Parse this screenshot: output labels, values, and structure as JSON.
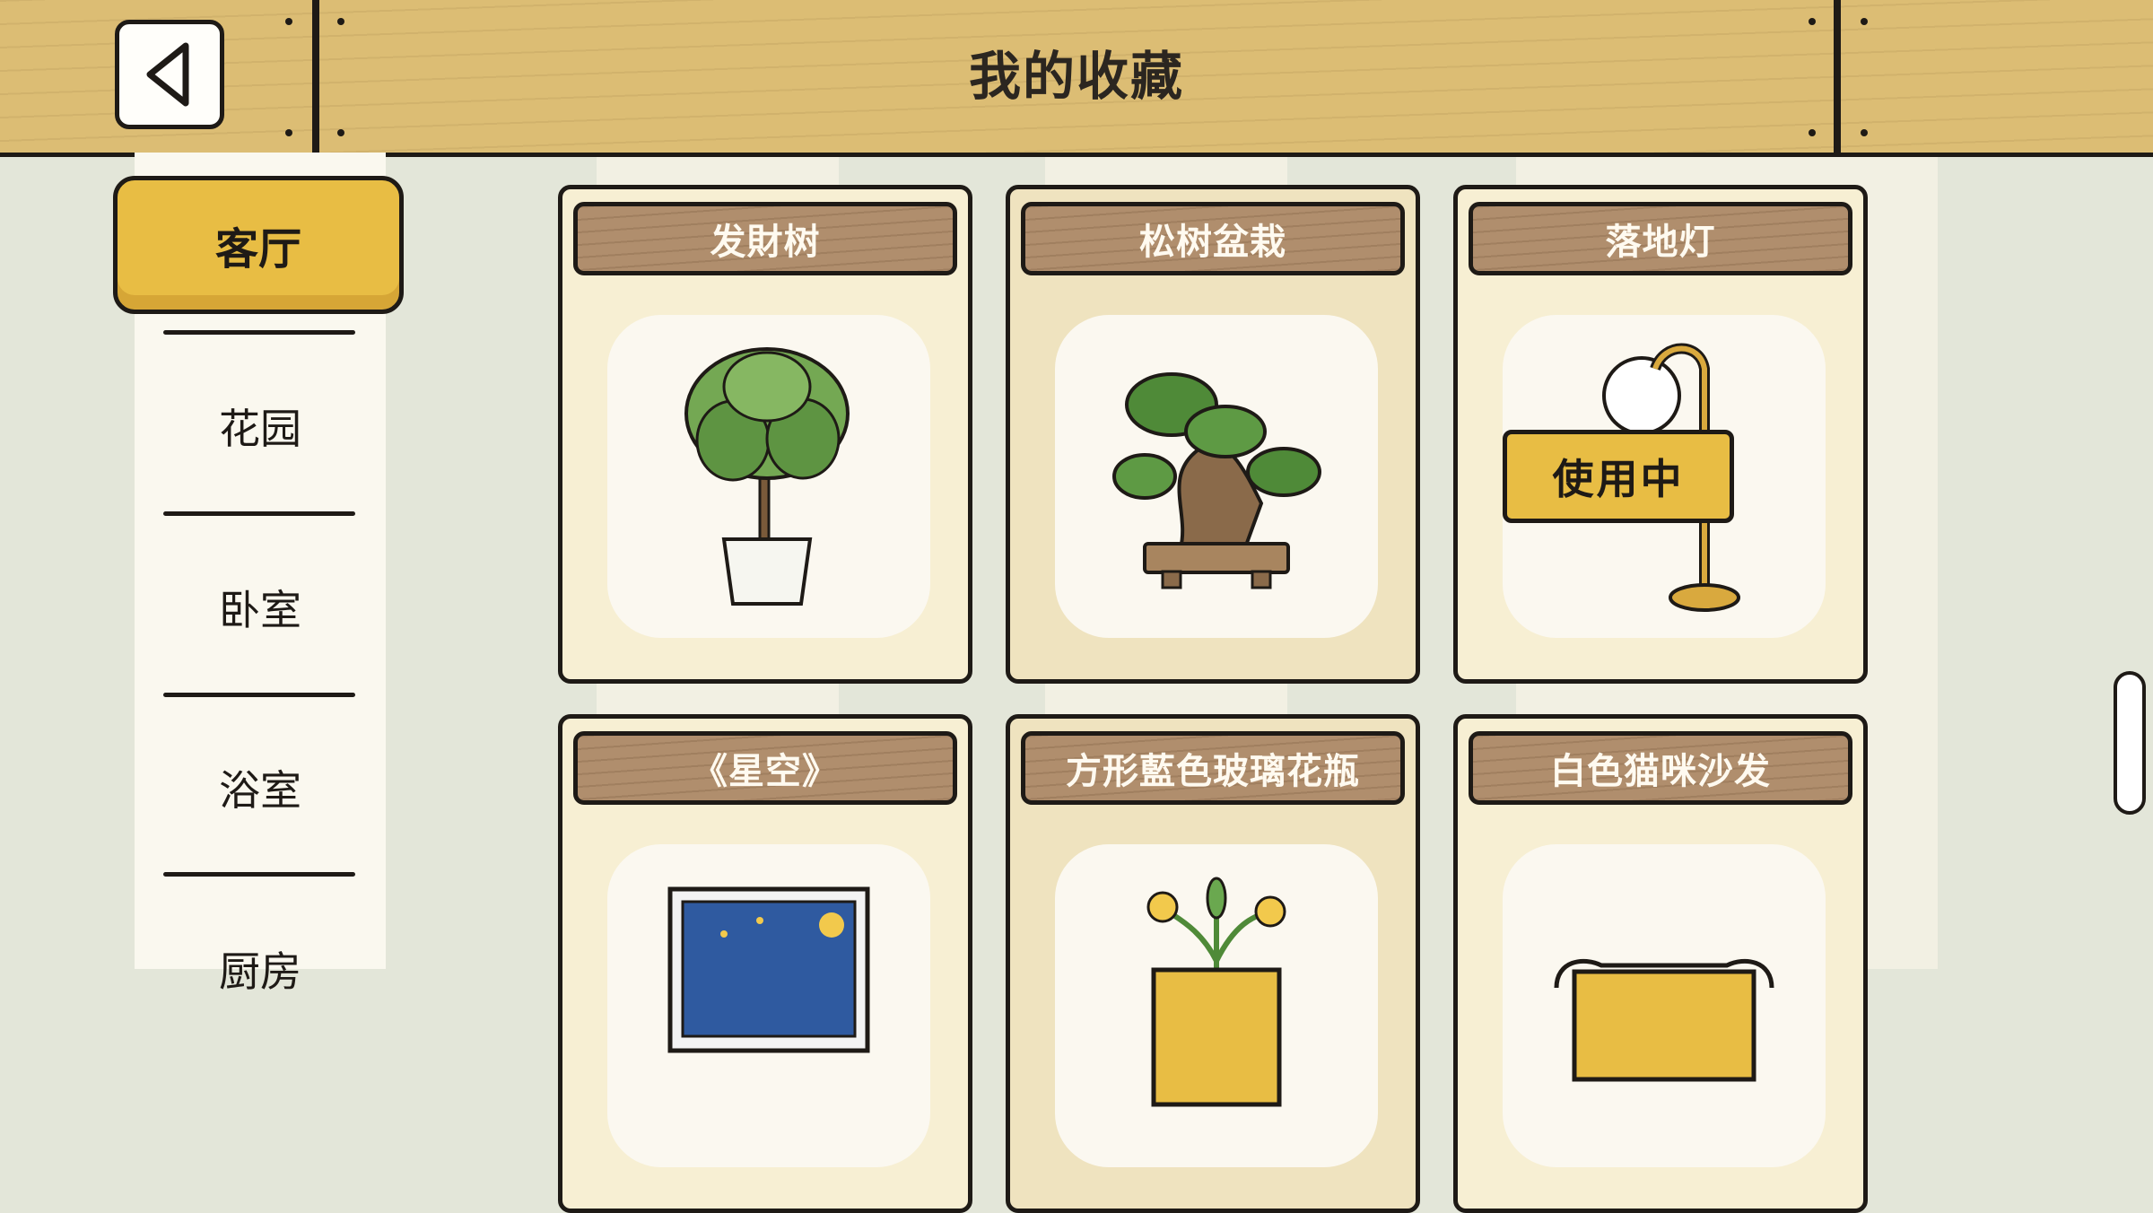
{
  "header": {
    "title": "我的收藏"
  },
  "sidebar": {
    "items": [
      {
        "label": "客厅",
        "active": true
      },
      {
        "label": "花园",
        "active": false
      },
      {
        "label": "卧室",
        "active": false
      },
      {
        "label": "浴室",
        "active": false
      },
      {
        "label": "厨房",
        "active": false
      }
    ]
  },
  "items": [
    {
      "name": "发財树",
      "icon": "money-tree-icon"
    },
    {
      "name": "松树盆栽",
      "icon": "bonsai-icon"
    },
    {
      "name": "落地灯",
      "icon": "floor-lamp-icon",
      "status": "使用中"
    },
    {
      "name": "《星空》",
      "icon": "painting-icon"
    },
    {
      "name": "方形藍色玻璃花瓶",
      "icon": "vase-icon"
    },
    {
      "name": "白色猫咪沙发",
      "icon": "cat-sofa-icon"
    }
  ],
  "colors": {
    "header_wood": "#dcbd74",
    "active_tab": "#e8bd44",
    "label_wood": "#b08e6d",
    "outline": "#1e1a16"
  }
}
